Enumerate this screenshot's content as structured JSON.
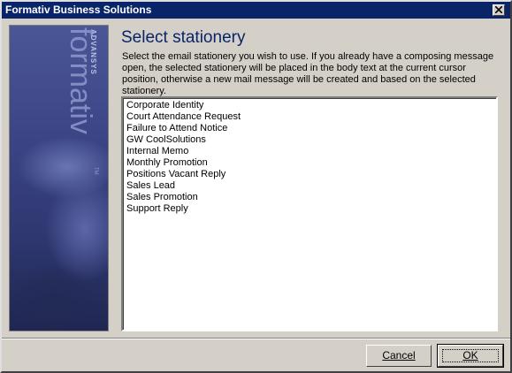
{
  "window": {
    "title": "Formativ Business Solutions"
  },
  "banner": {
    "brand": "formativ",
    "company": "ADVANSYS",
    "trademark": "TM"
  },
  "heading": "Select stationery",
  "description": "Select the email stationery you wish to use. If you already have a composing message open, the selected stationery will be placed in the body text at the current cursor position, otherwise a new mail message will be created and based on the selected stationery.",
  "stationery_list": {
    "items": [
      "Corporate Identity",
      "Court Attendance Request",
      "Failure to Attend Notice",
      "GW CoolSolutions",
      "Internal Memo",
      "Monthly Promotion",
      "Positions Vacant Reply",
      "Sales Lead",
      "Sales Promotion",
      "Support Reply"
    ]
  },
  "buttons": {
    "cancel": "Cancel",
    "ok": "OK"
  },
  "colors": {
    "titlebar": "#0a246a",
    "heading": "#0a246a",
    "dialog_bg": "#d4d0c8",
    "banner": "#3a4484"
  }
}
